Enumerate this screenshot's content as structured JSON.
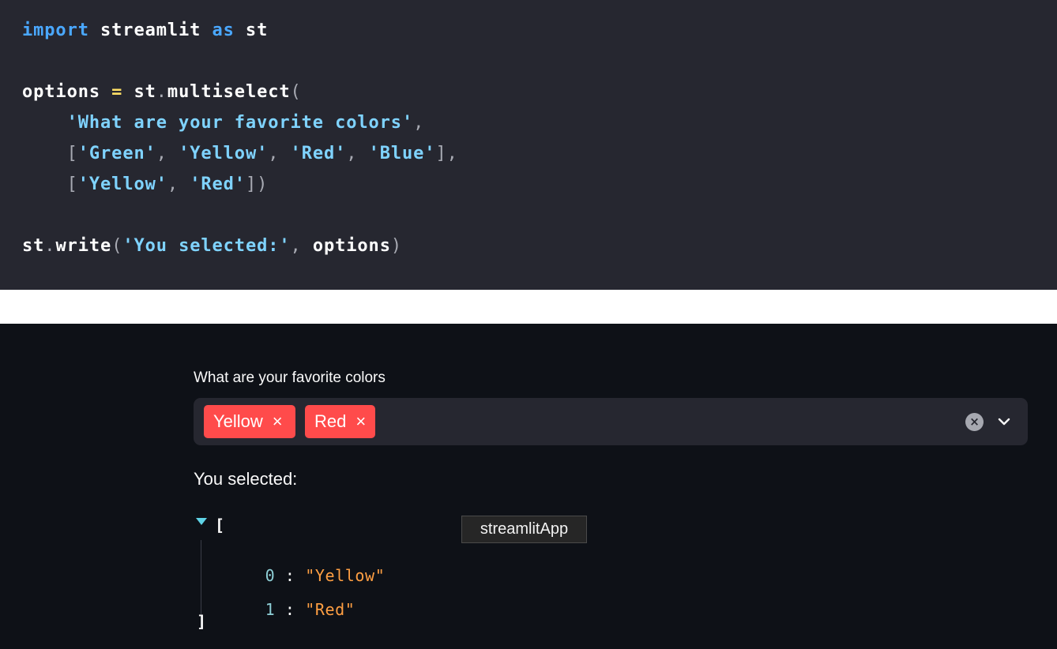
{
  "code": {
    "lines": [
      {
        "tokens": [
          {
            "t": "import",
            "c": "kw"
          },
          {
            "t": " streamlit ",
            "c": ""
          },
          {
            "t": "as",
            "c": "kw"
          },
          {
            "t": " st",
            "c": ""
          }
        ]
      },
      {
        "tokens": []
      },
      {
        "tokens": [
          {
            "t": "options ",
            "c": ""
          },
          {
            "t": "=",
            "c": "op"
          },
          {
            "t": " st",
            "c": ""
          },
          {
            "t": ".",
            "c": "pn"
          },
          {
            "t": "multiselect",
            "c": ""
          },
          {
            "t": "(",
            "c": "pn"
          }
        ]
      },
      {
        "tokens": [
          {
            "t": "    ",
            "c": ""
          },
          {
            "t": "'What are your favorite colors'",
            "c": "str"
          },
          {
            "t": ",",
            "c": "pn"
          }
        ]
      },
      {
        "tokens": [
          {
            "t": "    ",
            "c": ""
          },
          {
            "t": "[",
            "c": "pn"
          },
          {
            "t": "'Green'",
            "c": "str"
          },
          {
            "t": ", ",
            "c": "pn"
          },
          {
            "t": "'Yellow'",
            "c": "str"
          },
          {
            "t": ", ",
            "c": "pn"
          },
          {
            "t": "'Red'",
            "c": "str"
          },
          {
            "t": ", ",
            "c": "pn"
          },
          {
            "t": "'Blue'",
            "c": "str"
          },
          {
            "t": "],",
            "c": "pn"
          }
        ]
      },
      {
        "tokens": [
          {
            "t": "    ",
            "c": ""
          },
          {
            "t": "[",
            "c": "pn"
          },
          {
            "t": "'Yellow'",
            "c": "str"
          },
          {
            "t": ", ",
            "c": "pn"
          },
          {
            "t": "'Red'",
            "c": "str"
          },
          {
            "t": "])",
            "c": "pn"
          }
        ]
      },
      {
        "tokens": []
      },
      {
        "tokens": [
          {
            "t": "st",
            "c": ""
          },
          {
            "t": ".",
            "c": "pn"
          },
          {
            "t": "write",
            "c": ""
          },
          {
            "t": "(",
            "c": "pn"
          },
          {
            "t": "'You selected:'",
            "c": "str"
          },
          {
            "t": ", ",
            "c": "pn"
          },
          {
            "t": "options",
            "c": ""
          },
          {
            "t": ")",
            "c": "pn"
          }
        ]
      }
    ]
  },
  "app": {
    "multiselect": {
      "label": "What are your favorite colors",
      "selected": [
        "Yellow",
        "Red"
      ],
      "tag_remove_glyph": "×",
      "clear_glyph": "×",
      "clear_icon": "clear-all-icon",
      "dropdown_icon": "chevron-down-icon",
      "tag_color": "#ff4b4b"
    },
    "write_text": "You selected:",
    "json": {
      "open_bracket": "[",
      "close_bracket": "]",
      "items": [
        {
          "index": "0",
          "sep": ":",
          "value": "\"Yellow\""
        },
        {
          "index": "1",
          "sep": ":",
          "value": "\"Red\""
        }
      ]
    },
    "tooltip": "streamlitApp"
  },
  "colors": {
    "code_bg": "#262730",
    "app_bg": "#0e1117",
    "widget_bg": "#262730",
    "accent": "#ff4b4b"
  }
}
